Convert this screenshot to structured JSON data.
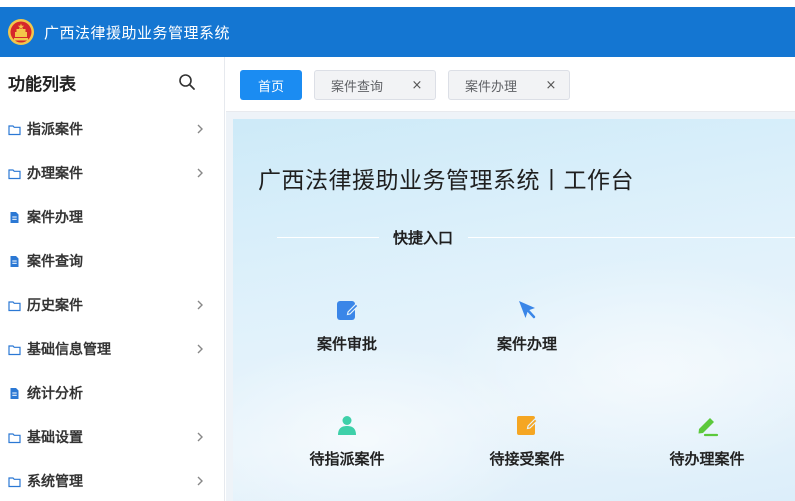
{
  "app": {
    "title": "广西法律援助业务管理系统"
  },
  "sidebar": {
    "title": "功能列表",
    "items": [
      {
        "label": "指派案件",
        "icon": "folder-icon",
        "expandable": true
      },
      {
        "label": "办理案件",
        "icon": "folder-icon",
        "expandable": true
      },
      {
        "label": "案件办理",
        "icon": "document-icon",
        "expandable": false
      },
      {
        "label": "案件查询",
        "icon": "document-icon",
        "expandable": false
      },
      {
        "label": "历史案件",
        "icon": "folder-icon",
        "expandable": true
      },
      {
        "label": "基础信息管理",
        "icon": "folder-icon",
        "expandable": true
      },
      {
        "label": "统计分析",
        "icon": "document-icon",
        "expandable": false
      },
      {
        "label": "基础设置",
        "icon": "folder-icon",
        "expandable": true
      },
      {
        "label": "系统管理",
        "icon": "folder-icon",
        "expandable": true
      }
    ]
  },
  "tabs": [
    {
      "label": "首页",
      "active": true,
      "closable": false
    },
    {
      "label": "案件查询",
      "active": false,
      "closable": true,
      "close": "×"
    },
    {
      "label": "案件办理",
      "active": false,
      "closable": true,
      "close": "×"
    }
  ],
  "main": {
    "title": "广西法律援助业务管理系统丨工作台",
    "quick_title": "快捷入口",
    "quick_links": [
      {
        "label": "案件审批",
        "icon": "edit-document-icon",
        "color": "#3a86e8"
      },
      {
        "label": "案件办理",
        "icon": "cursor-pointer-icon",
        "color": "#3a86e8"
      },
      {
        "label": "待指派案件",
        "icon": "user-icon",
        "color": "#3ed0a9"
      },
      {
        "label": "待接受案件",
        "icon": "edit-document-icon",
        "color": "#f5a623"
      },
      {
        "label": "待办理案件",
        "icon": "pen-icon",
        "color": "#5cc93c"
      }
    ]
  },
  "colors": {
    "brand": "#1476d2",
    "accent": "#1b8cf2",
    "icon": "#2b78d4"
  }
}
